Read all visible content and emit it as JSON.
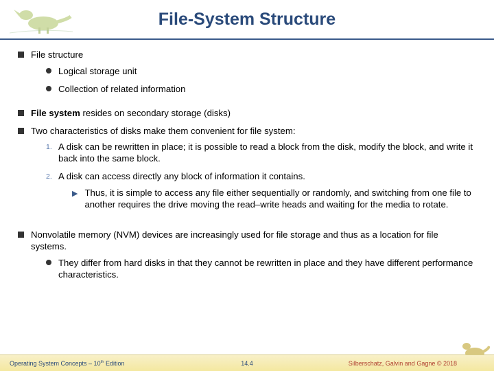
{
  "title": "File-System Structure",
  "bullets": {
    "b1": "File structure",
    "b1a": "Logical storage unit",
    "b1b": "Collection of related information",
    "b2_pre": "File system",
    "b2_post": " resides on secondary storage (disks)",
    "b3": "Two characteristics of disks make them convenient for file system:",
    "b3_1": "A disk can be rewritten in place; it is possible to read a block from the disk, modify the block, and write it back into the same block.",
    "b3_2": "A disk can access directly any block of information it contains.",
    "b3_2a": "Thus, it is simple to access any file either sequentially or randomly, and switching from one file to another requires the drive moving the read–write heads and waiting for the media to rotate.",
    "b4": "Nonvolatile memory (NVM) devices are increasingly used for file storage and thus as a location for file systems.",
    "b4a": "They differ from hard disks in that they cannot be rewritten in place and they have different performance characteristics."
  },
  "footer": {
    "left_pre": "Operating System Concepts – 10",
    "left_sup": "th",
    "left_post": " Edition",
    "center": "14.4",
    "right": "Silberschatz, Galvin and Gagne © 2018"
  }
}
